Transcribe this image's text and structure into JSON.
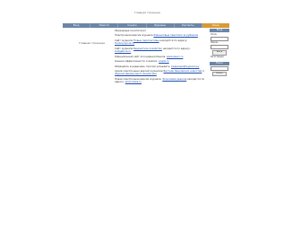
{
  "header": {
    "title": "Главная страница"
  },
  "nav": {
    "items": [
      {
        "label": "Вход"
      },
      {
        "label": "Новости"
      },
      {
        "label": "Ссылки"
      },
      {
        "label": "Журналы"
      },
      {
        "label": "Контакты"
      },
      {
        "label": "Меню"
      }
    ],
    "active_index": 5
  },
  "left": {
    "logo_text": "Главная страница"
  },
  "main": {
    "greeting": "Уважаемые посетители!",
    "paragraphs": [
      {
        "text": "Электронная версия журнала",
        "link": "Финансовые практики за рубежом",
        "tail": ""
      },
      {
        "text": "Сайт журнала",
        "link": "Новые перспективы",
        "tail": "находится по адресу:",
        "link2": "fondovyrynok.ru"
      },
      {
        "text": "Сайт журнала",
        "link": "Бюджетное хозяйство",
        "tail": "находится по адресу:",
        "link2": "budgetnoe.ru"
      },
      {
        "text": "Официальный сайт Ассоциации банков:",
        "link": "www.assoc.ru",
        "tail": ""
      },
      {
        "text": "Оценка эффективности и анализ:",
        "link": "analiz.ru",
        "tail": ""
      },
      {
        "text": "Обращаясь в редакцию, просим указывать:",
        "link": "редакция@журнал.ру",
        "tail": ""
      },
      {
        "text": "Архив электронных версий журналов",
        "link": "Вестник банковских новостей",
        "tail": "и",
        "link2": "Журнал финансового аналитика",
        "tail2": ""
      },
      {
        "text": "Новая электронная версия журнала:",
        "link": "Экономика рынков",
        "tail": "находится по адресу:",
        "link2": "ekonomika.ru"
      }
    ]
  },
  "sidebar": {
    "title": "Вход",
    "login_label": "Логин",
    "password_label": "Пароль",
    "submit_label": "Войти",
    "register_label": "Регистрация",
    "search_label": "Поиск",
    "search_button": "Искать"
  }
}
